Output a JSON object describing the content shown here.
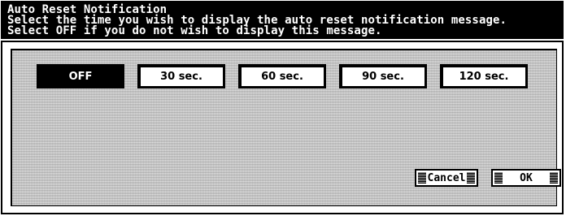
{
  "title": {
    "heading": "Auto Reset Notification",
    "line1": "Select the time you wish to display the auto reset notification message.",
    "line2": "Select OFF if you do not wish to display this message."
  },
  "options": [
    {
      "label": "OFF",
      "selected": true
    },
    {
      "label": "30 sec.",
      "selected": false
    },
    {
      "label": "60 sec.",
      "selected": false
    },
    {
      "label": "90 sec.",
      "selected": false
    },
    {
      "label": "120 sec.",
      "selected": false
    }
  ],
  "footer": {
    "cancel_label": "Cancel",
    "ok_label": "OK"
  }
}
